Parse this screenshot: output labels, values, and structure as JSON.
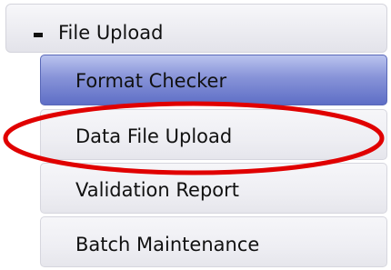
{
  "menu": {
    "section_icon": "collapse-minus-icon",
    "section_label": "File Upload",
    "items": [
      {
        "label": "Format Checker",
        "state": "active"
      },
      {
        "label": "Data File Upload",
        "state": "normal"
      },
      {
        "label": "Validation Report",
        "state": "normal"
      },
      {
        "label": "Batch Maintenance",
        "state": "normal"
      }
    ]
  },
  "annotation": {
    "type": "ellipse-highlight",
    "target": "Data File Upload",
    "color": "#e00000"
  },
  "colors": {
    "active_item": "#7f8cd5",
    "item_background": "#ececf1",
    "text": "#111111"
  }
}
